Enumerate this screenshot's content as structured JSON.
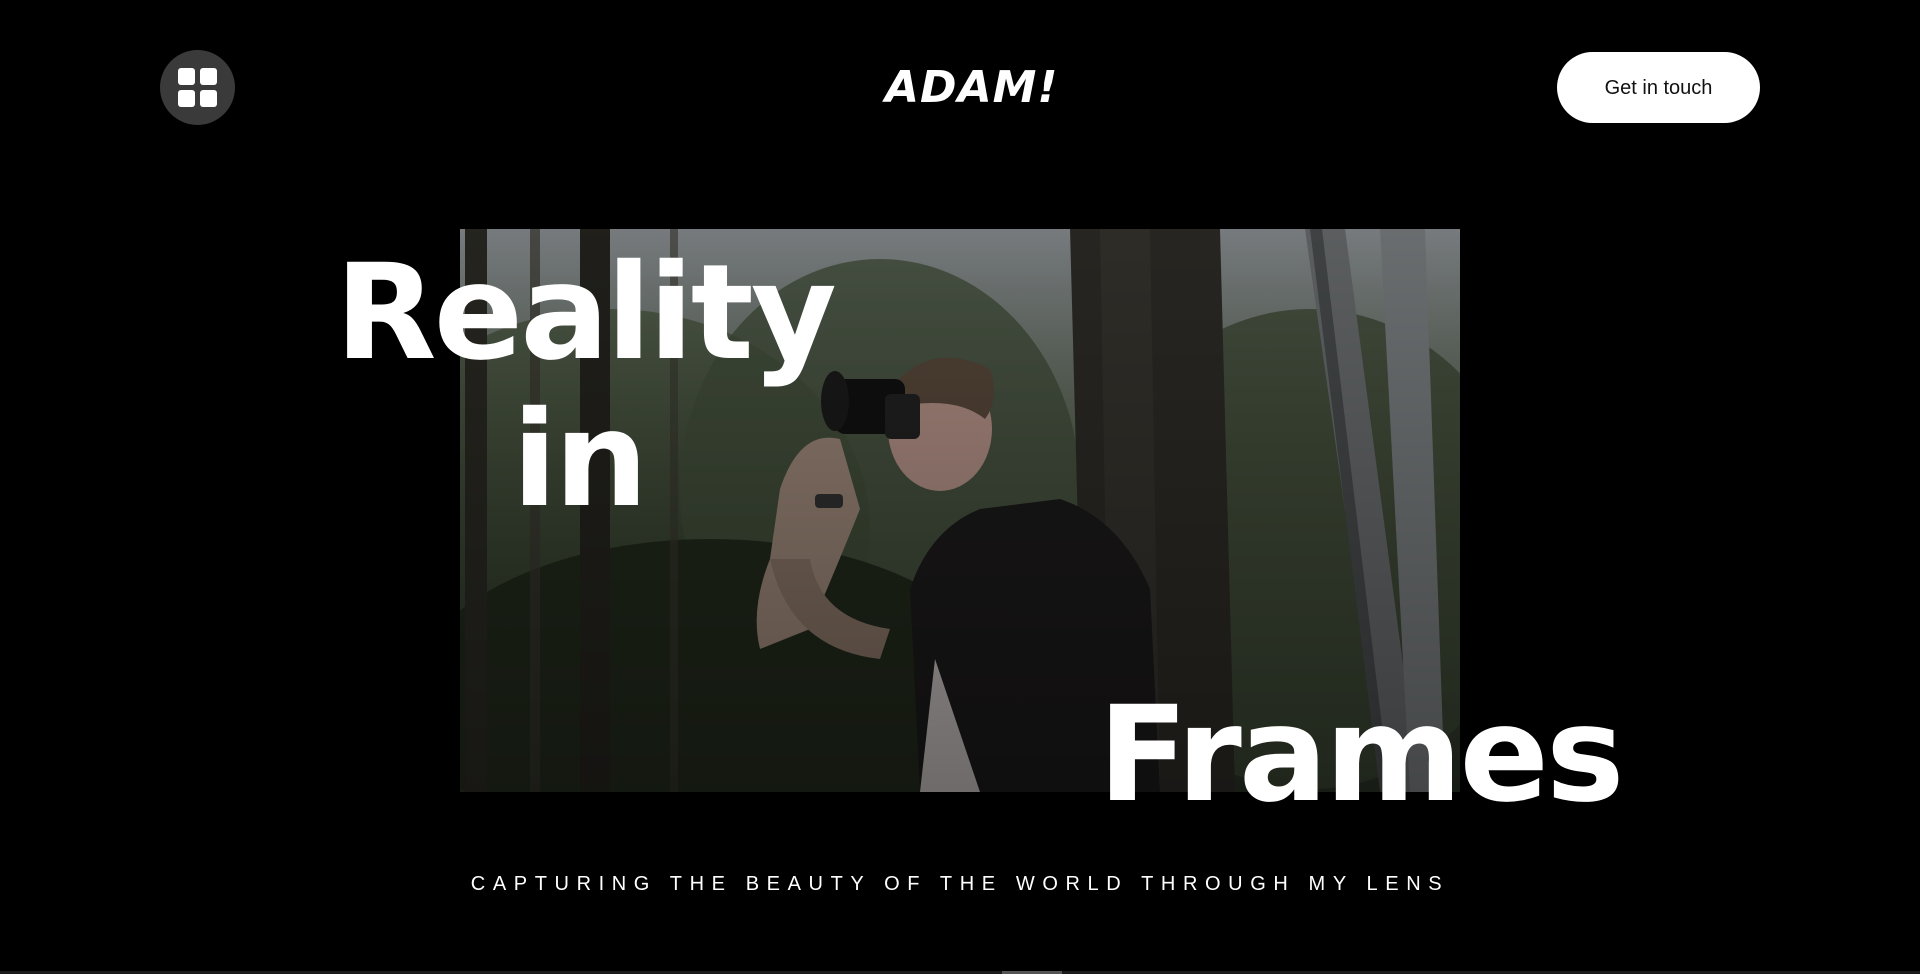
{
  "header": {
    "menu_icon": "grid-icon",
    "logo": "ADAM!",
    "cta_label": "Get in touch"
  },
  "hero": {
    "headline_words": [
      "Reality",
      "in",
      "Frames"
    ],
    "tagline": "CAPTURING THE BEAUTY OF THE WORLD THROUGH MY LENS",
    "photo_description_icon": "photographer-in-forest-image"
  },
  "colors": {
    "background": "#000000",
    "text": "#ffffff",
    "menu_button": "#3a3a3a",
    "cta_background": "#ffffff",
    "cta_text": "#111111"
  }
}
